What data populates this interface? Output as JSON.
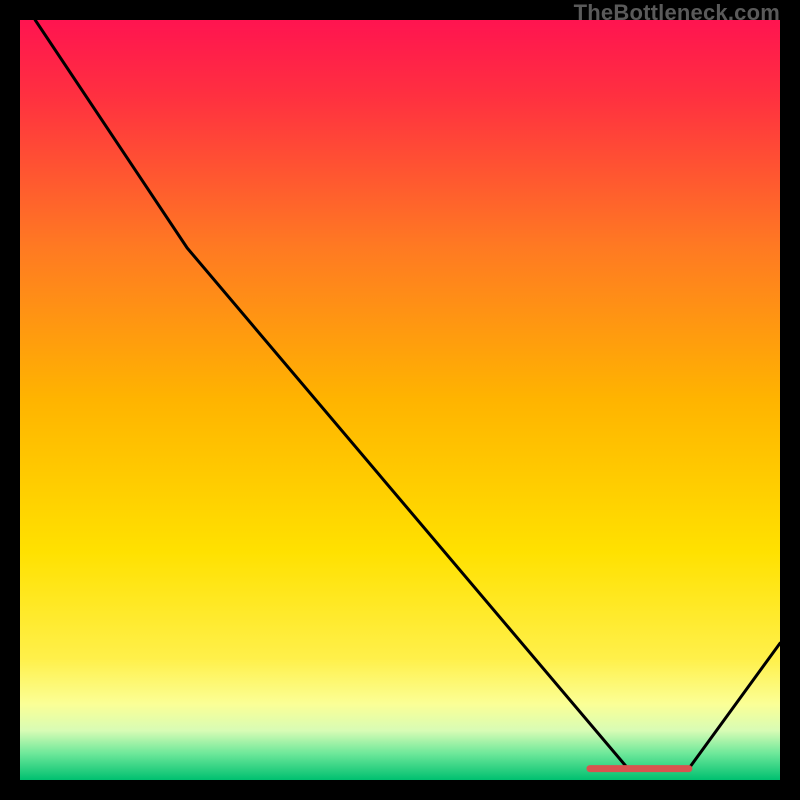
{
  "watermark": "TheBottleneck.com",
  "chart_data": {
    "type": "line",
    "title": "",
    "xlabel": "",
    "ylabel": "",
    "xlim": [
      0,
      100
    ],
    "ylim": [
      0,
      100
    ],
    "grid": false,
    "legend": false,
    "series": [
      {
        "name": "curve",
        "x": [
          2,
          22,
          80,
          88,
          100
        ],
        "y": [
          100,
          70,
          1.5,
          1.5,
          18
        ]
      }
    ],
    "marker_segment": {
      "description": "short red horizontal segment at the curve minimum",
      "x": [
        75,
        88
      ],
      "y": [
        1.5,
        1.5
      ],
      "color": "#d9534f"
    },
    "background_gradient": {
      "direction": "vertical",
      "stops": [
        {
          "pos": 0.0,
          "color": "#ff1450"
        },
        {
          "pos": 0.1,
          "color": "#ff3040"
        },
        {
          "pos": 0.3,
          "color": "#ff7a22"
        },
        {
          "pos": 0.5,
          "color": "#ffb400"
        },
        {
          "pos": 0.7,
          "color": "#ffe100"
        },
        {
          "pos": 0.84,
          "color": "#fff04a"
        },
        {
          "pos": 0.9,
          "color": "#fbff96"
        },
        {
          "pos": 0.935,
          "color": "#d8fcb5"
        },
        {
          "pos": 0.965,
          "color": "#6ee89a"
        },
        {
          "pos": 1.0,
          "color": "#00c070"
        }
      ]
    }
  }
}
